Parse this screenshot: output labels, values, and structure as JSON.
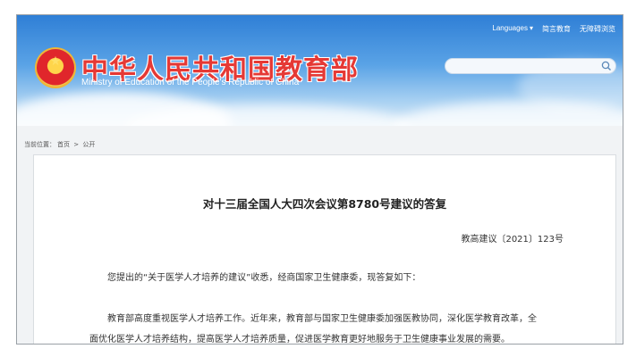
{
  "header": {
    "site_title": "中华人民共和国教育部",
    "site_subtitle": "Ministry of Education of the People's Republic of China",
    "top_links": [
      "Languages",
      "简言教育",
      "无障碍浏览"
    ],
    "search": {
      "placeholder": "",
      "value": ""
    }
  },
  "breadcrumb": {
    "label": "当前位置：",
    "items": [
      "首页",
      "公开"
    ],
    "separator": ">"
  },
  "document": {
    "title": "对十三届全国人大四次会议第8780号建议的答复",
    "number": "教高建议〔2021〕123号",
    "paragraphs": [
      "您提出的“关于医学人才培养的建议”收悉，经商国家卫生健康委，现答复如下：",
      "教育部高度重视医学人才培养工作。近年来，教育部与国家卫生健康委加强医教协同，深化医学教育改革，全",
      "面优化医学人才培养结构，提高医学人才培养质量，促进医学教育更好地服务于卫生健康事业发展的需要。"
    ]
  },
  "colors": {
    "title_red": "#e53935",
    "banner_blue": "#2f7fd6"
  },
  "icons": [
    "national-emblem-icon",
    "search-icon",
    "chevron-down-icon"
  ]
}
